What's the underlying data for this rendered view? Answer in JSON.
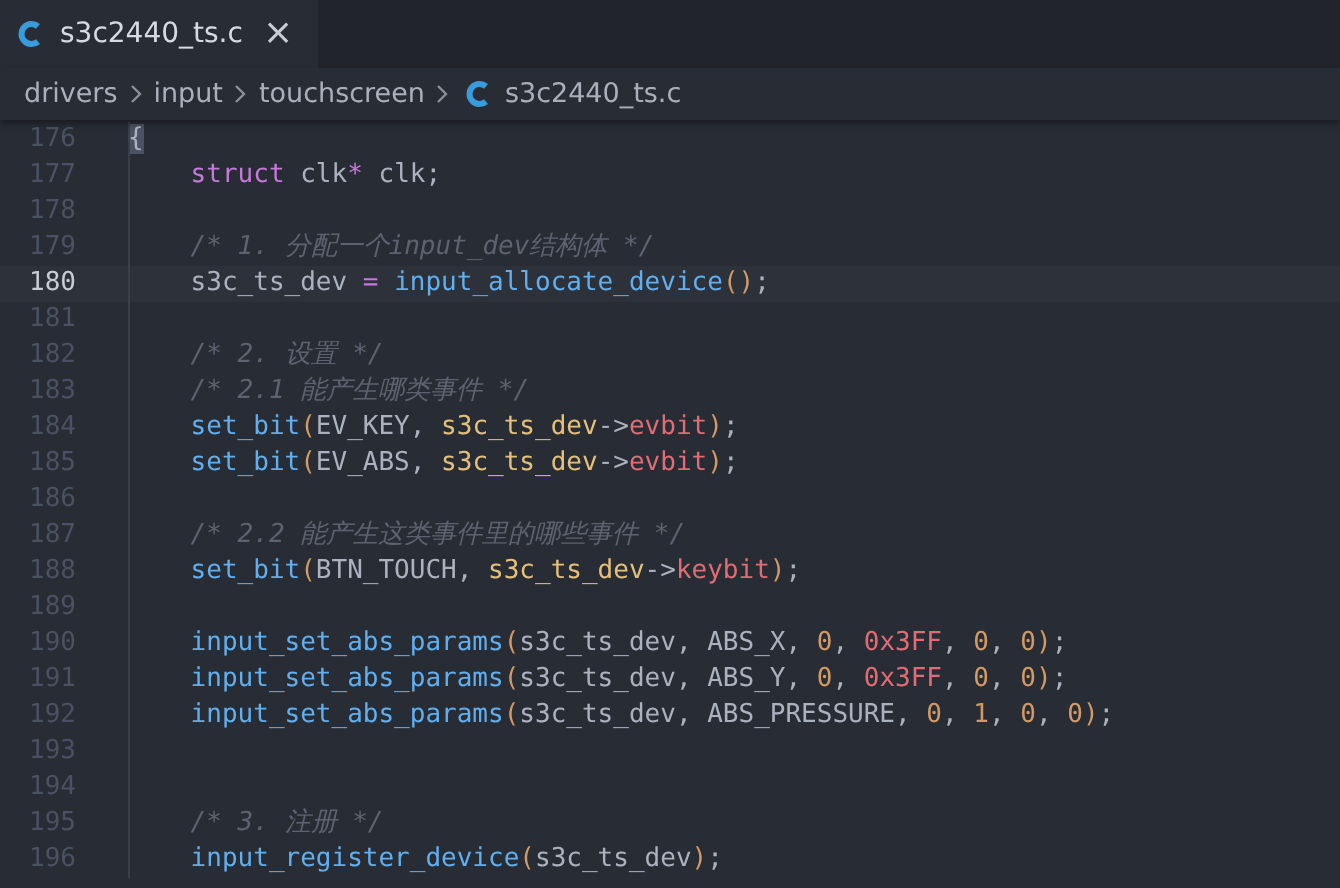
{
  "tabs": [
    {
      "label": "s3c2440_ts.c",
      "close": "×",
      "selected": true
    }
  ],
  "breadcrumbs": [
    {
      "label": "drivers",
      "kind": "folder"
    },
    {
      "label": "input",
      "kind": "folder"
    },
    {
      "label": "touchscreen",
      "kind": "folder"
    },
    {
      "label": "s3c2440_ts.c",
      "kind": "file"
    }
  ],
  "lines": [
    {
      "number": "176",
      "current": false,
      "tokens": [
        {
          "kind": "matched",
          "text": "{"
        }
      ]
    },
    {
      "number": "177",
      "current": false,
      "tokens": [
        {
          "kind": "keyword",
          "text": "    struct"
        },
        {
          "kind": "plain",
          "text": " clk"
        },
        {
          "kind": "operator",
          "text": "*"
        },
        {
          "kind": "plain",
          "text": " clk;"
        }
      ]
    },
    {
      "number": "178",
      "current": false
    },
    {
      "number": "179",
      "current": false,
      "tokens": [
        {
          "kind": "comment",
          "text": "    /* 1. 分配一个input_dev结构体 */"
        }
      ]
    },
    {
      "number": "180",
      "current": true,
      "tokens": [
        {
          "kind": "plain",
          "text": "    s3c_ts_dev "
        },
        {
          "kind": "operator",
          "text": "= "
        },
        {
          "kind": "function",
          "text": "input_allocate_device"
        },
        {
          "kind": "paren",
          "text": "()"
        },
        {
          "kind": "plain",
          "text": ";"
        }
      ]
    },
    {
      "number": "181",
      "current": false
    },
    {
      "number": "182",
      "current": false,
      "tokens": [
        {
          "kind": "comment",
          "text": "    /* 2. 设置 */"
        }
      ]
    },
    {
      "number": "183",
      "current": false,
      "tokens": [
        {
          "kind": "comment",
          "text": "    /* 2.1 能产生哪类事件 */"
        }
      ]
    },
    {
      "number": "184",
      "current": false,
      "tokens": [
        {
          "kind": "function",
          "text": "    set_bit"
        },
        {
          "kind": "paren",
          "text": "("
        },
        {
          "kind": "plain",
          "text": "EV_KEY, "
        },
        {
          "kind": "variable",
          "text": "s3c_ts_dev"
        },
        {
          "kind": "plain",
          "text": "->"
        },
        {
          "kind": "field",
          "text": "evbit"
        },
        {
          "kind": "paren",
          "text": ")"
        },
        {
          "kind": "plain",
          "text": ";"
        }
      ]
    },
    {
      "number": "185",
      "current": false,
      "tokens": [
        {
          "kind": "function",
          "text": "    set_bit"
        },
        {
          "kind": "paren",
          "text": "("
        },
        {
          "kind": "plain",
          "text": "EV_ABS, "
        },
        {
          "kind": "variable",
          "text": "s3c_ts_dev"
        },
        {
          "kind": "plain",
          "text": "->"
        },
        {
          "kind": "field",
          "text": "evbit"
        },
        {
          "kind": "paren",
          "text": ")"
        },
        {
          "kind": "plain",
          "text": ";"
        }
      ]
    },
    {
      "number": "186",
      "current": false
    },
    {
      "number": "187",
      "current": false,
      "tokens": [
        {
          "kind": "comment",
          "text": "    /* 2.2 能产生这类事件里的哪些事件 */"
        }
      ]
    },
    {
      "number": "188",
      "current": false,
      "tokens": [
        {
          "kind": "function",
          "text": "    set_bit"
        },
        {
          "kind": "paren",
          "text": "("
        },
        {
          "kind": "plain",
          "text": "BTN_TOUCH, "
        },
        {
          "kind": "variable",
          "text": "s3c_ts_dev"
        },
        {
          "kind": "plain",
          "text": "->"
        },
        {
          "kind": "field",
          "text": "keybit"
        },
        {
          "kind": "paren",
          "text": ")"
        },
        {
          "kind": "plain",
          "text": ";"
        }
      ]
    },
    {
      "number": "189",
      "current": false
    },
    {
      "number": "190",
      "current": false,
      "tokens": [
        {
          "kind": "function",
          "text": "    input_set_abs_params"
        },
        {
          "kind": "paren",
          "text": "("
        },
        {
          "kind": "plain",
          "text": "s3c_ts_dev, ABS_X, "
        },
        {
          "kind": "number",
          "text": "0"
        },
        {
          "kind": "plain",
          "text": ", "
        },
        {
          "kind": "hex",
          "text": "0x3FF"
        },
        {
          "kind": "plain",
          "text": ", "
        },
        {
          "kind": "number",
          "text": "0"
        },
        {
          "kind": "plain",
          "text": ", "
        },
        {
          "kind": "number",
          "text": "0"
        },
        {
          "kind": "paren",
          "text": ")"
        },
        {
          "kind": "plain",
          "text": ";"
        }
      ]
    },
    {
      "number": "191",
      "current": false,
      "tokens": [
        {
          "kind": "function",
          "text": "    input_set_abs_params"
        },
        {
          "kind": "paren",
          "text": "("
        },
        {
          "kind": "plain",
          "text": "s3c_ts_dev, ABS_Y, "
        },
        {
          "kind": "number",
          "text": "0"
        },
        {
          "kind": "plain",
          "text": ", "
        },
        {
          "kind": "hex",
          "text": "0x3FF"
        },
        {
          "kind": "plain",
          "text": ", "
        },
        {
          "kind": "number",
          "text": "0"
        },
        {
          "kind": "plain",
          "text": ", "
        },
        {
          "kind": "number",
          "text": "0"
        },
        {
          "kind": "paren",
          "text": ")"
        },
        {
          "kind": "plain",
          "text": ";"
        }
      ]
    },
    {
      "number": "192",
      "current": false,
      "tokens": [
        {
          "kind": "function",
          "text": "    input_set_abs_params"
        },
        {
          "kind": "paren",
          "text": "("
        },
        {
          "kind": "plain",
          "text": "s3c_ts_dev, ABS_PRESSURE, "
        },
        {
          "kind": "number",
          "text": "0"
        },
        {
          "kind": "plain",
          "text": ", "
        },
        {
          "kind": "number",
          "text": "1"
        },
        {
          "kind": "plain",
          "text": ", "
        },
        {
          "kind": "number",
          "text": "0"
        },
        {
          "kind": "plain",
          "text": ", "
        },
        {
          "kind": "number",
          "text": "0"
        },
        {
          "kind": "paren",
          "text": ")"
        },
        {
          "kind": "plain",
          "text": ";"
        }
      ]
    },
    {
      "number": "193",
      "current": false
    },
    {
      "number": "194",
      "current": false
    },
    {
      "number": "195",
      "current": false,
      "tokens": [
        {
          "kind": "comment",
          "text": "    /* 3. 注册 */"
        }
      ]
    },
    {
      "number": "196",
      "current": false,
      "tokens": [
        {
          "kind": "function",
          "text": "    input_register_device"
        },
        {
          "kind": "paren",
          "text": "("
        },
        {
          "kind": "plain",
          "text": "s3c_ts_dev"
        },
        {
          "kind": "paren",
          "text": ")"
        },
        {
          "kind": "plain",
          "text": ";"
        }
      ]
    }
  ]
}
